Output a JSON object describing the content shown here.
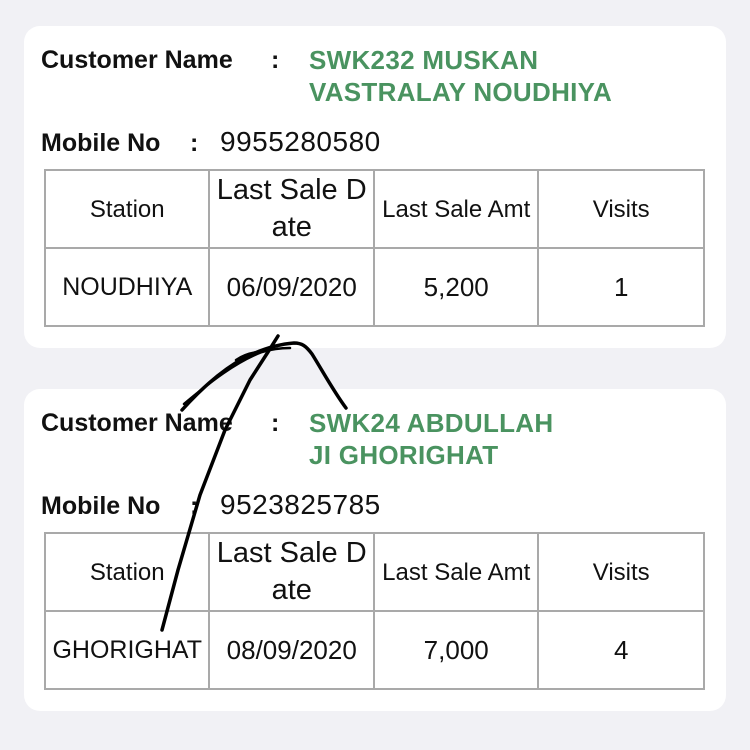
{
  "customers": [
    {
      "name_label": "Customer Name",
      "colon": ":",
      "name_line1": "SWK232 MUSKAN",
      "name_line2": "VASTRALAY NOUDHIYA",
      "mobile_label": "Mobile No",
      "mobile": "9955280580",
      "table": {
        "headers": [
          "Station",
          "Last Sale Date",
          "Last Sale Amt",
          "Visits"
        ],
        "row": {
          "station": "NOUDHIYA",
          "last_sale_date": "06/09/2020",
          "last_sale_amt": "5,200",
          "visits": "1"
        }
      }
    },
    {
      "name_label": "Customer Name",
      "colon": ":",
      "name_line1": "SWK24 ABDULLAH",
      "name_line2": "JI GHORIGHAT",
      "mobile_label": "Mobile No",
      "mobile": "9523825785",
      "table": {
        "headers": [
          "Station",
          "Last Sale Date",
          "Last Sale Amt",
          "Visits"
        ],
        "row": {
          "station": "GHORIGHAT",
          "last_sale_date": "08/09/2020",
          "last_sale_amt": "7,000",
          "visits": "4"
        }
      }
    }
  ],
  "colors": {
    "name_green": "#4a9360",
    "background": "#f1f1f5",
    "card": "#ffffff",
    "border": "#a9a9a9"
  }
}
